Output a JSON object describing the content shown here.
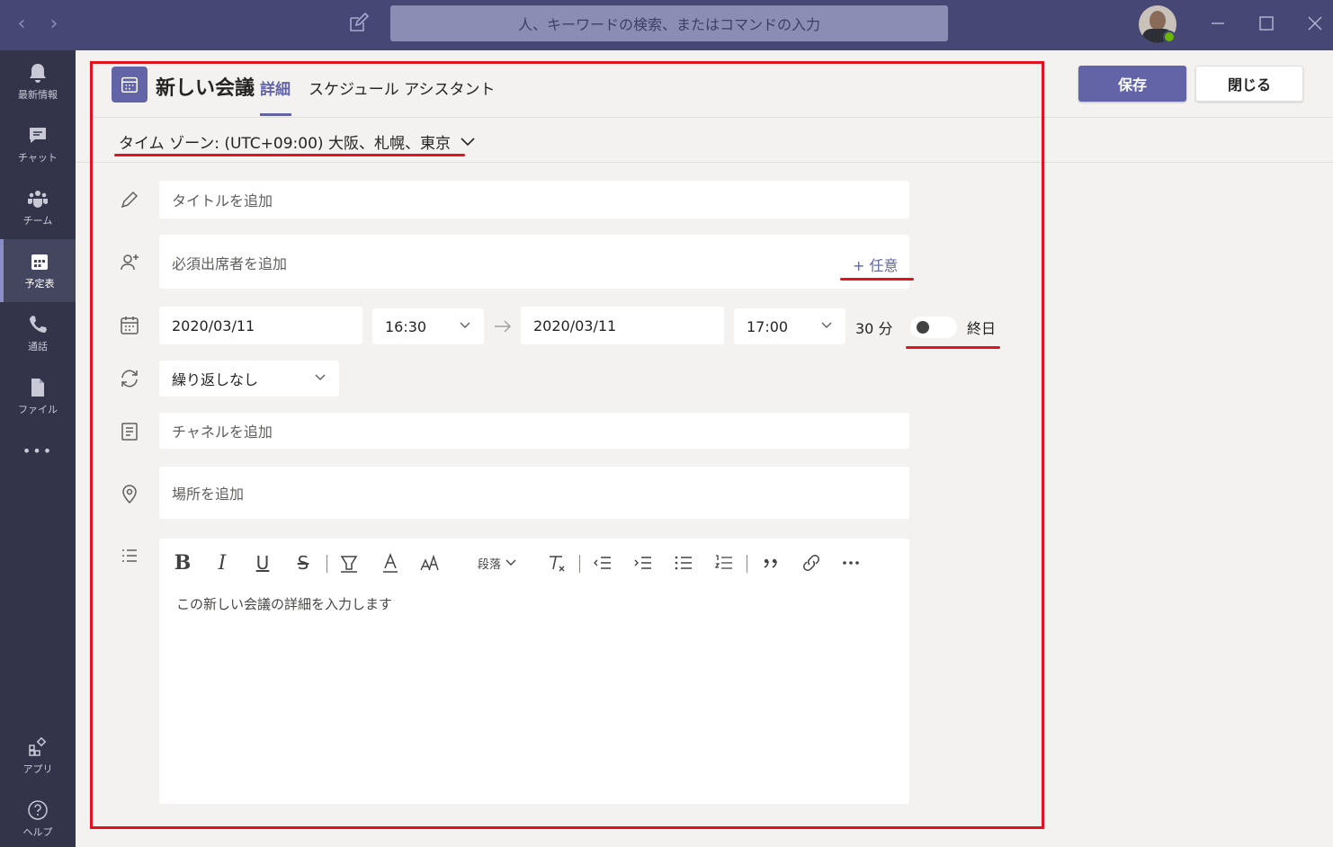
{
  "titlebar": {
    "search_placeholder": "人、キーワードの検索、またはコマンドの入力",
    "back_glyph": "‹",
    "forward_glyph": "›"
  },
  "rail": {
    "items": [
      {
        "label": "最新情報",
        "icon": "bell-icon"
      },
      {
        "label": "チャット",
        "icon": "chat-icon"
      },
      {
        "label": "チーム",
        "icon": "teams-icon"
      },
      {
        "label": "予定表",
        "icon": "calendar-icon",
        "active": true
      },
      {
        "label": "通話",
        "icon": "phone-icon"
      },
      {
        "label": "ファイル",
        "icon": "file-icon"
      },
      {
        "label": "アプリ",
        "icon": "apps-icon"
      },
      {
        "label": "ヘルプ",
        "icon": "help-icon"
      }
    ],
    "more_glyph": "•••"
  },
  "header": {
    "title": "新しい会議",
    "tabs": [
      {
        "label": "詳細",
        "active": true
      },
      {
        "label": "スケジュール アシスタント"
      }
    ],
    "save_label": "保存",
    "close_label": "閉じる"
  },
  "timezone": {
    "label": "タイム ゾーン: (UTC+09:00) 大阪、札幌、東京"
  },
  "form": {
    "title_placeholder": "タイトルを追加",
    "attendees_placeholder": "必須出席者を追加",
    "optional_label": "+ 任意",
    "start_date": "2020/03/11",
    "start_time": "16:30",
    "end_date": "2020/03/11",
    "end_time": "17:00",
    "duration": "30 分",
    "all_day_label": "終日",
    "all_day_on": false,
    "repeat": "繰り返しなし",
    "channel_placeholder": "チャネルを追加",
    "location_placeholder": "場所を追加"
  },
  "editor": {
    "paragraph_label": "段落",
    "placeholder": "この新しい会議の詳細を入力します"
  },
  "colors": {
    "accent": "#6264a7",
    "titlebar": "#464775",
    "rail": "#33344a",
    "highlight_red": "#e0141e"
  }
}
